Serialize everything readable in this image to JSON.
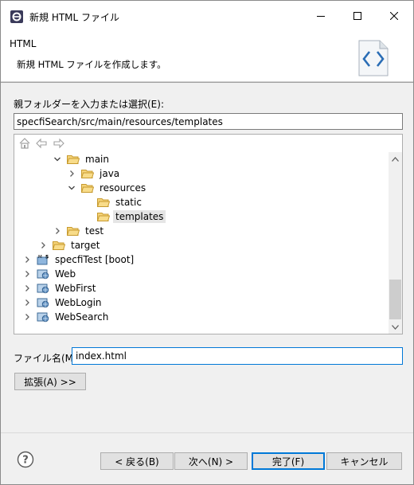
{
  "window": {
    "title": "新規 HTML ファイル"
  },
  "banner": {
    "title": "HTML",
    "description": "新規 HTML ファイルを作成します。"
  },
  "folder": {
    "label": "親フォルダーを入力または選択(E):",
    "value": "specfiSearch/src/main/resources/templates"
  },
  "tree": {
    "items": [
      {
        "label": "main",
        "type": "folder",
        "expanded": true
      },
      {
        "label": "java",
        "type": "folder",
        "expanded": false
      },
      {
        "label": "resources",
        "type": "folder",
        "expanded": true
      },
      {
        "label": "static",
        "type": "folder"
      },
      {
        "label": "templates",
        "type": "folder",
        "selected": true
      },
      {
        "label": "test",
        "type": "folder",
        "expanded": false
      },
      {
        "label": "target",
        "type": "folder",
        "expanded": false
      },
      {
        "label": "specfiTest [boot]",
        "type": "project-boot",
        "expanded": false
      },
      {
        "label": "Web",
        "type": "project-web",
        "expanded": false
      },
      {
        "label": "WebFirst",
        "type": "project-web",
        "expanded": false
      },
      {
        "label": "WebLogin",
        "type": "project-web",
        "expanded": false
      },
      {
        "label": "WebSearch",
        "type": "project-web",
        "expanded": false
      }
    ]
  },
  "filename": {
    "label": "ファイル名(M):",
    "value": "index.html"
  },
  "buttons": {
    "advanced": "拡張(A) >>",
    "back": "< 戻る(B)",
    "next": "次へ(N) >",
    "finish": "完了(F)",
    "cancel": "キャンセル"
  },
  "colors": {
    "accent": "#0078d7",
    "folder": "#e8b84a",
    "selection": "#e5e5e5"
  }
}
